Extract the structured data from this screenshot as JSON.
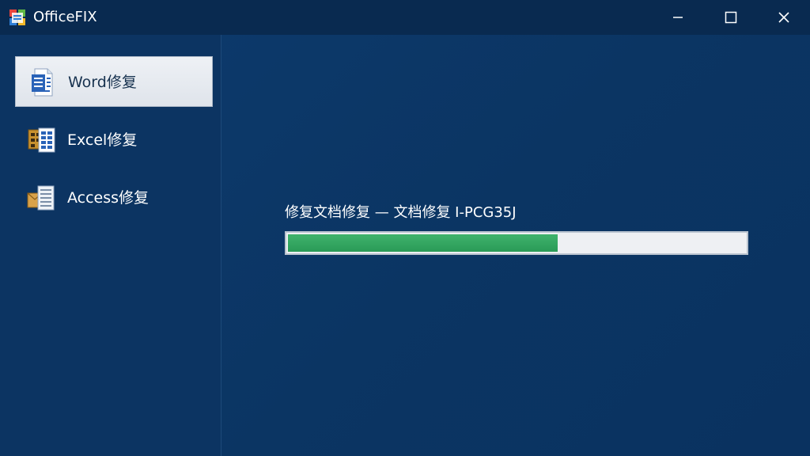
{
  "window": {
    "title": "OfficeFIX",
    "icons": {
      "app": "officefix-logo-icon",
      "minimize": "minimize-icon",
      "maximize": "maximize-icon",
      "close": "close-icon"
    }
  },
  "sidebar": {
    "items": [
      {
        "label": "Word修复",
        "icon": "word-document-icon",
        "active": true
      },
      {
        "label": "Excel修复",
        "icon": "excel-spreadsheet-icon",
        "active": false
      },
      {
        "label": "Access修复",
        "icon": "access-database-icon",
        "active": false
      }
    ]
  },
  "main": {
    "status_text": "修复文档修复 —   文档修复 I-PCG35J",
    "progress_fraction": 0.59
  },
  "colors": {
    "background": "#0c3564",
    "titlebar": "#092a50",
    "active_item": "#e6eaf0",
    "progress_fill": "#2fa660",
    "progress_track": "#eef0f3"
  }
}
